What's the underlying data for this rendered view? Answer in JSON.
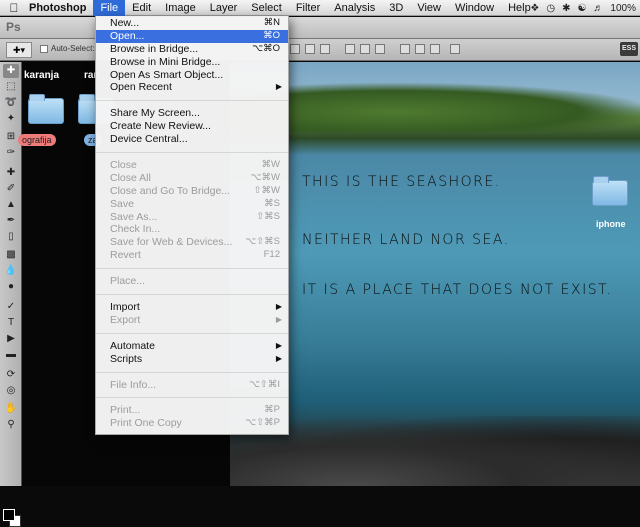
{
  "menubar": {
    "app": "Photoshop",
    "items": [
      "File",
      "Edit",
      "Image",
      "Layer",
      "Select",
      "Filter",
      "Analysis",
      "3D",
      "View",
      "Window",
      "Help"
    ],
    "battery": "100%"
  },
  "optionsbar": {
    "ps_logo": "Ps",
    "auto_select": "Auto-Select:",
    "essentials": "ESS"
  },
  "desktop": {
    "left_labels": [
      "karanja",
      "ran"
    ],
    "tag_red": "ografija",
    "tag_blue": "za",
    "iphone_label": "iphone"
  },
  "canvas_text": {
    "line1": "THIS IS THE SEASHORE.",
    "line2": "NEITHER LAND NOR SEA.",
    "line3": "IT IS A PLACE THAT DOES NOT EXIST."
  },
  "file_menu": {
    "group1": [
      {
        "label": "New...",
        "shortcut": "⌘N",
        "state": "normal"
      },
      {
        "label": "Open...",
        "shortcut": "⌘O",
        "state": "highlight"
      },
      {
        "label": "Browse in Bridge...",
        "shortcut": "⌥⌘O",
        "state": "normal"
      },
      {
        "label": "Browse in Mini Bridge...",
        "shortcut": "",
        "state": "normal"
      },
      {
        "label": "Open As Smart Object...",
        "shortcut": "",
        "state": "normal"
      },
      {
        "label": "Open Recent",
        "shortcut": "",
        "state": "submenu"
      }
    ],
    "group2": [
      {
        "label": "Share My Screen...",
        "shortcut": ""
      },
      {
        "label": "Create New Review...",
        "shortcut": ""
      },
      {
        "label": "Device Central...",
        "shortcut": ""
      }
    ],
    "group3": [
      {
        "label": "Close",
        "shortcut": "⌘W"
      },
      {
        "label": "Close All",
        "shortcut": "⌥⌘W"
      },
      {
        "label": "Close and Go To Bridge...",
        "shortcut": "⇧⌘W"
      },
      {
        "label": "Save",
        "shortcut": "⌘S"
      },
      {
        "label": "Save As...",
        "shortcut": "⇧⌘S"
      },
      {
        "label": "Check In...",
        "shortcut": ""
      },
      {
        "label": "Save for Web & Devices...",
        "shortcut": "⌥⇧⌘S"
      },
      {
        "label": "Revert",
        "shortcut": "F12"
      }
    ],
    "place": "Place...",
    "import": "Import",
    "export": "Export",
    "automate": "Automate",
    "scripts": "Scripts",
    "file_info": {
      "label": "File Info...",
      "shortcut": "⌥⇧⌘I"
    },
    "print": {
      "label": "Print...",
      "shortcut": "⌘P"
    },
    "print_one": {
      "label": "Print One Copy",
      "shortcut": "⌥⇧⌘P"
    }
  }
}
